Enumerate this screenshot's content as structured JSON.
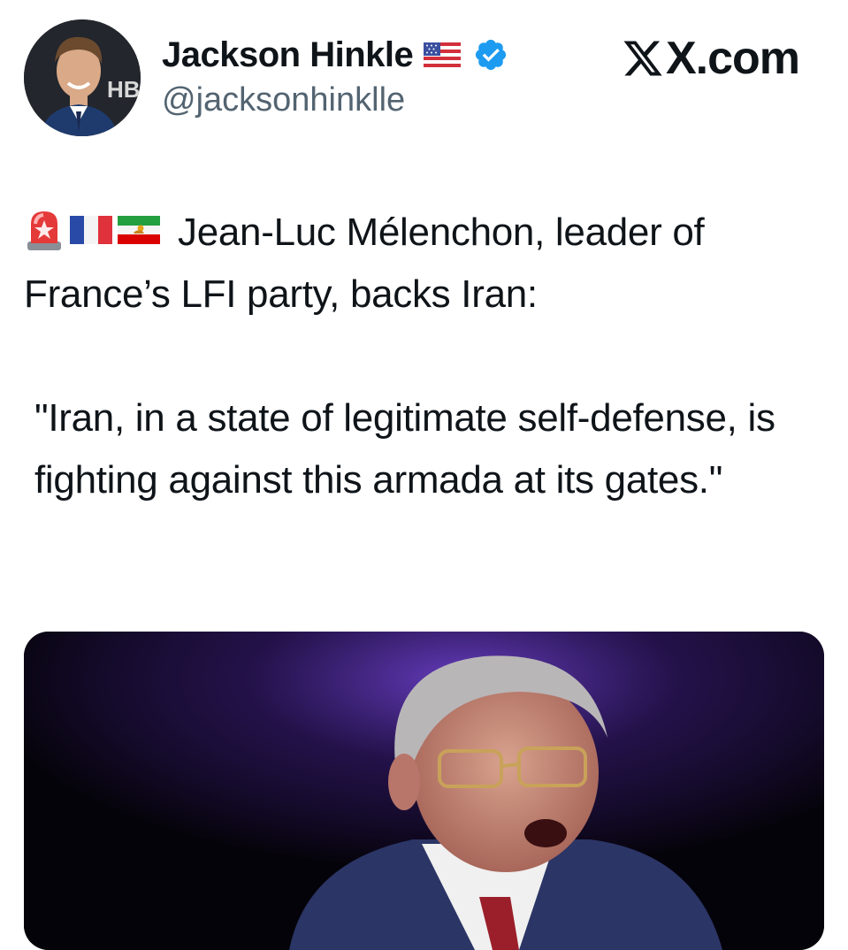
{
  "header": {
    "display_name": "Jackson Hinkle",
    "handle": "@jacksonhinklle",
    "avatar_badge_text": "HB",
    "brand": "X.com"
  },
  "tweet": {
    "emojis": [
      "rotating-light-emoji",
      "flag-france-emoji",
      "flag-iran-lion-sun-emoji"
    ],
    "lead": "Jean-Luc Mélenchon, leader of France’s LFI party, backs Iran:",
    "quote": "\"Iran, in a state of legitimate self-defense, is fighting against this armada at its gates.\""
  },
  "colors": {
    "text": "#0f1419",
    "secondary": "#536471",
    "verified": "#1d9bf0",
    "media_bg": "#06030a"
  }
}
